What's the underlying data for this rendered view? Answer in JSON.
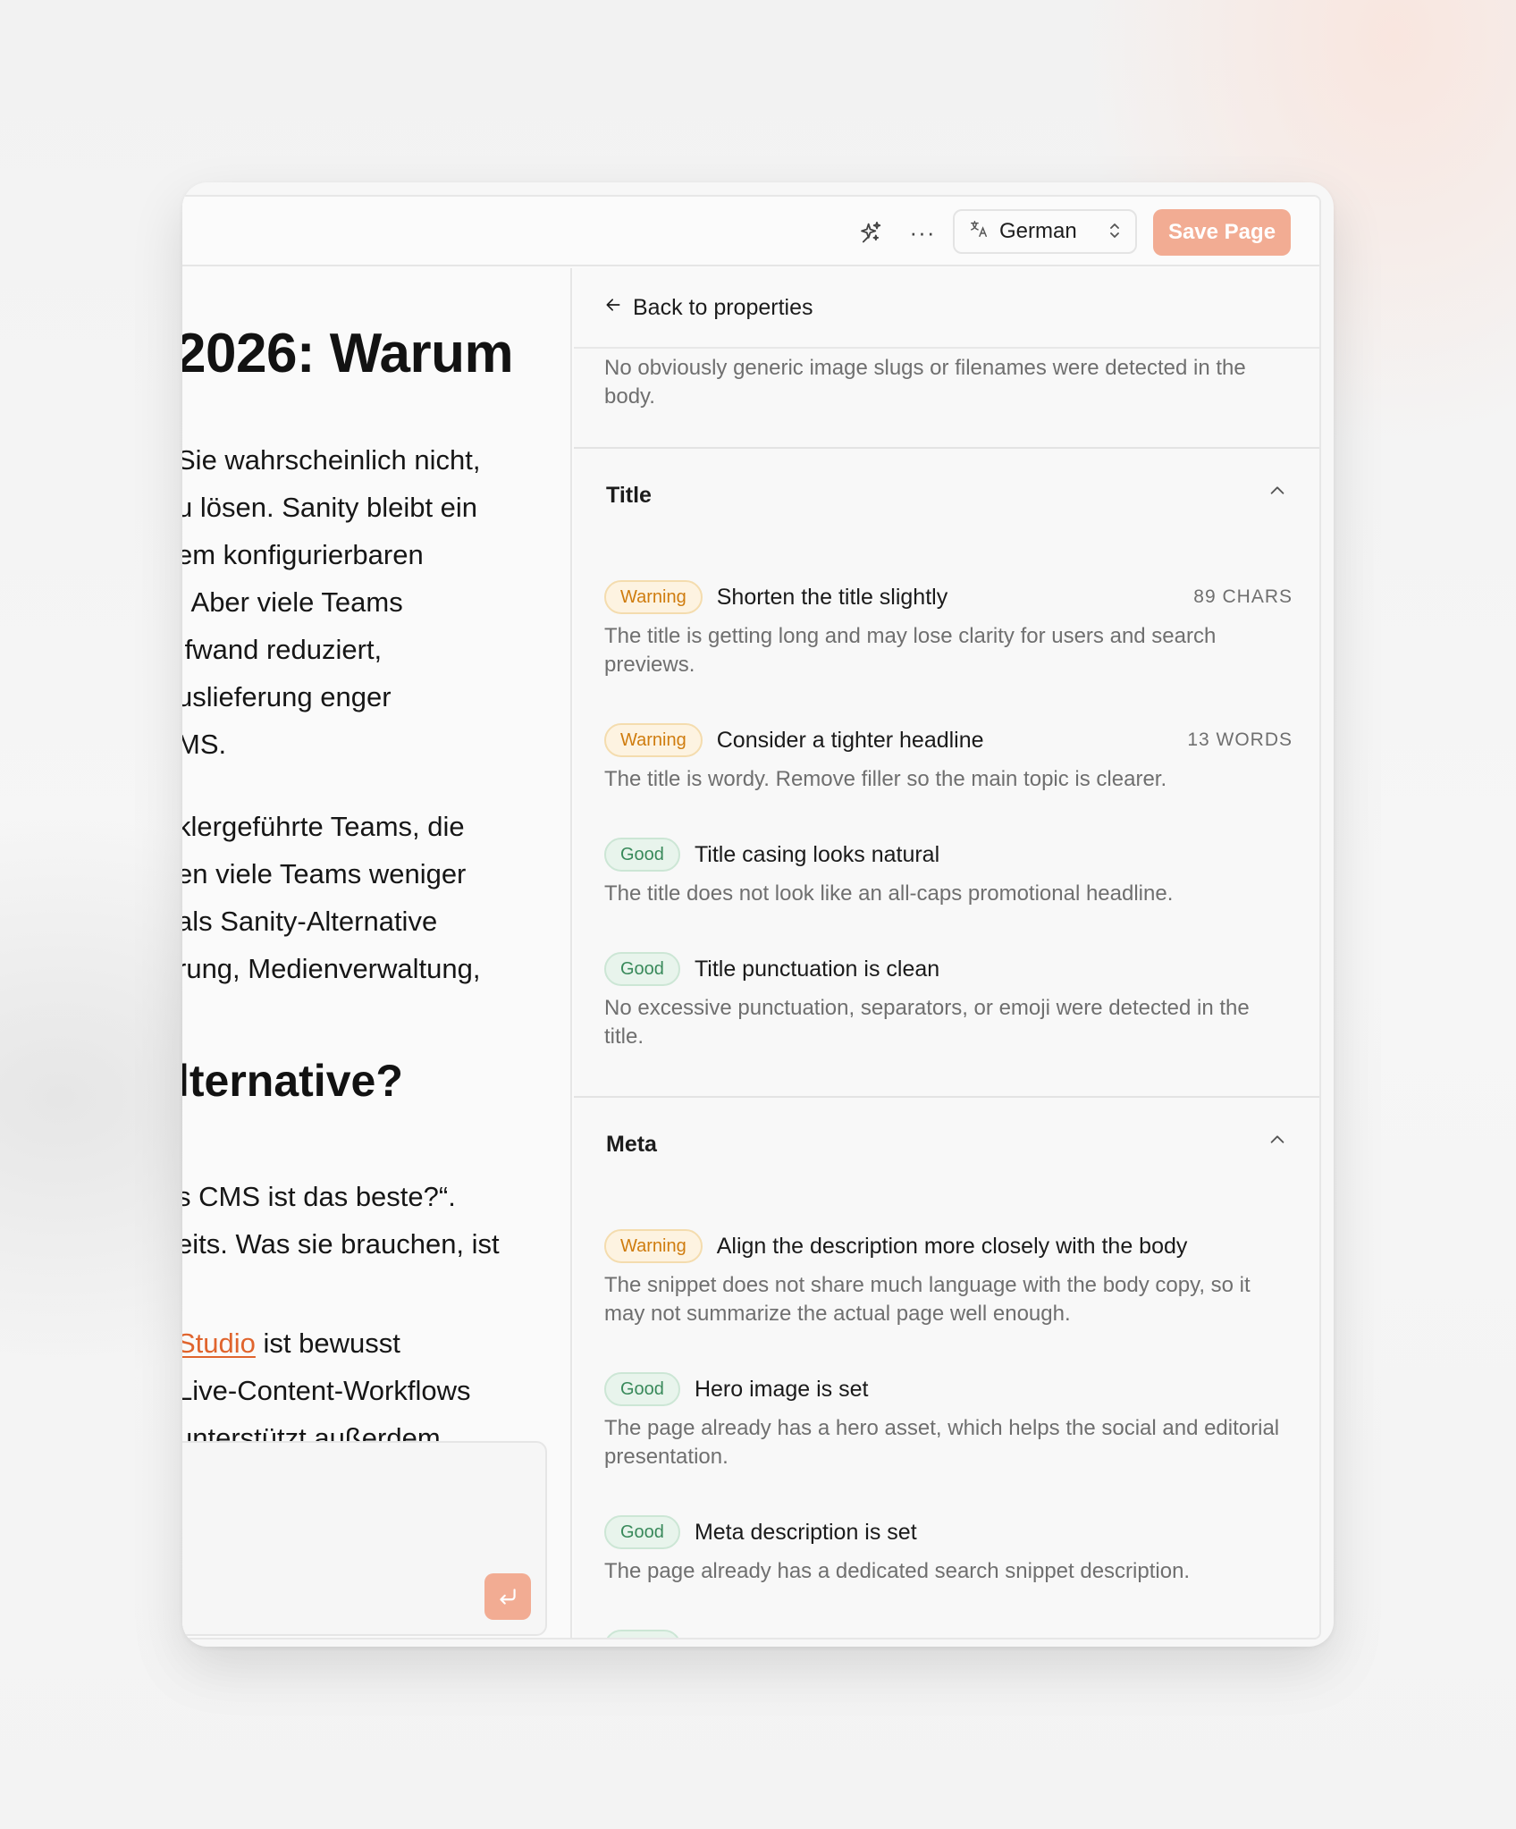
{
  "toolbar": {
    "language": "German",
    "save_label": "Save Page",
    "more_label": "···"
  },
  "editor": {
    "heading1": "2026: Warum",
    "paragraph1": [
      "Sie wahrscheinlich nicht,",
      "u lösen. Sanity bleibt ein",
      "em konfigurierbaren",
      ". Aber viele Teams",
      "ıfwand reduziert,",
      "uslieferung enger",
      "MS."
    ],
    "paragraph2": [
      "klergeführte Teams, die",
      "en viele Teams weniger",
      "als Sanity-Alternative",
      "rung, Medienverwaltung,"
    ],
    "heading2": "lternative?",
    "paragraph3": [
      "s CMS ist das beste?“.",
      "eits. Was sie brauchen, ist"
    ],
    "paragraph4_link": "Studio",
    "paragraph4_rest": " ist bewusst",
    "paragraph4": [
      " Live-Content-Workflows",
      "unterstützt außerdem"
    ]
  },
  "panel": {
    "back_label": "Back to properties",
    "intro": "No obviously generic image slugs or filenames were detected in the body.",
    "sections": [
      {
        "title": "Title",
        "checks": [
          {
            "status": "Warning",
            "title": "Shorten the title slightly",
            "count": "89 CHARS",
            "description": "The title is getting long and may lose clarity for users and search previews."
          },
          {
            "status": "Warning",
            "title": "Consider a tighter headline",
            "count": "13 WORDS",
            "description": "The title is wordy. Remove filler so the main topic is clearer."
          },
          {
            "status": "Good",
            "title": "Title casing looks natural",
            "count": "",
            "description": "The title does not look like an all-caps promotional headline."
          },
          {
            "status": "Good",
            "title": "Title punctuation is clean",
            "count": "",
            "description": "No excessive punctuation, separators, or emoji were detected in the title."
          }
        ]
      },
      {
        "title": "Meta",
        "checks": [
          {
            "status": "Warning",
            "title": "Align the description more closely with the body",
            "count": "",
            "description": "The snippet does not share much language with the body copy, so it may not summarize the actual page well enough."
          },
          {
            "status": "Good",
            "title": "Hero image is set",
            "count": "",
            "description": "The page already has a hero asset, which helps the social and editorial presentation."
          },
          {
            "status": "Good",
            "title": "Meta description is set",
            "count": "",
            "description": "The page already has a dedicated search snippet description."
          }
        ]
      }
    ]
  },
  "colors": {
    "accent": "#f2ac93",
    "link": "#e0642d",
    "warning": "#cf7c0e",
    "good": "#38895a"
  },
  "icons": [
    "sparkle-icon",
    "more-icon",
    "translate-icon",
    "chevron-updown-icon",
    "arrow-left-icon",
    "chevron-up-icon",
    "enter-icon"
  ]
}
